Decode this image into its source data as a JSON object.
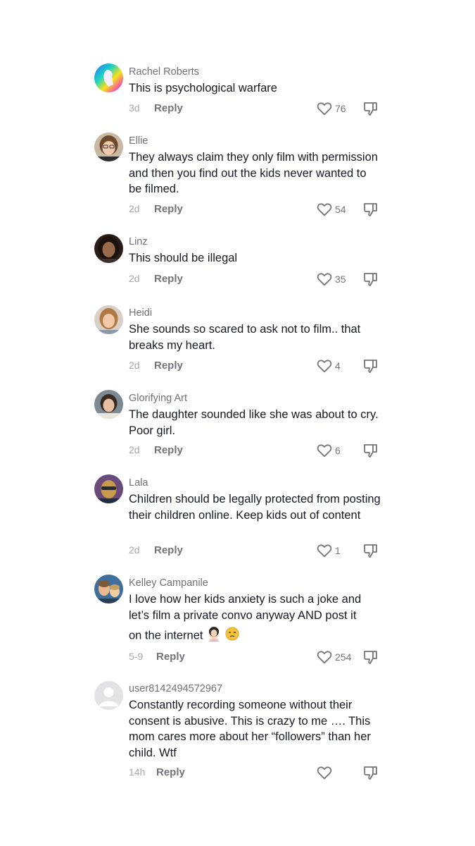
{
  "comments": [
    {
      "username": "Rachel Roberts",
      "text": "This is psychological warfare",
      "date": "3d",
      "reply": "Reply",
      "likes": "76",
      "avatar": "rainbow-art"
    },
    {
      "username": "Ellie",
      "text": "They always claim they only film with permission and then you find out the kids never wanted to be filmed.",
      "date": "2d",
      "reply": "Reply",
      "likes": "54",
      "avatar": "photo"
    },
    {
      "username": "Linz",
      "text": "This should be illegal",
      "date": "2d",
      "reply": "Reply",
      "likes": "35",
      "avatar": "photo"
    },
    {
      "username": "Heidi",
      "text": "She sounds so scared to ask not to film.. that breaks my heart.",
      "date": "2d",
      "reply": "Reply",
      "likes": "4",
      "avatar": "photo"
    },
    {
      "username": "Glorifying Art",
      "text": "The daughter sounded like she was about to cry. Poor girl.",
      "date": "2d",
      "reply": "Reply",
      "likes": "6",
      "avatar": "photo"
    },
    {
      "username": "Lala",
      "text": "Children should be legally protected from posting their children online. Keep kids out of content",
      "date": "2d",
      "reply": "Reply",
      "likes": "1",
      "avatar": "photo"
    },
    {
      "username": "Kelley Campanile",
      "text": "I love how her kids anxiety is such a joke and let’s film a private convo anyway AND post it",
      "text_line3": "on the internet",
      "emojis": [
        "woman-gesturing-no-emoji",
        "unamused-face-emoji"
      ],
      "date": "5-9",
      "reply": "Reply",
      "likes": "254",
      "avatar": "photo"
    },
    {
      "username": "user8142494572967",
      "text": "Constantly recording someone without their consent is abusive. This is crazy to me …. This mom cares more about her “followers” than her child. Wtf",
      "date": "14h",
      "reply": "Reply",
      "likes": "",
      "avatar": "default-avatar"
    }
  ],
  "icons": {
    "like": "heart-outline-icon",
    "dislike": "thumbs-down-icon"
  },
  "colors": {
    "text": "#161823",
    "username": "#6f7078",
    "muted": "#a6a7ab",
    "reply": "#73747a"
  }
}
